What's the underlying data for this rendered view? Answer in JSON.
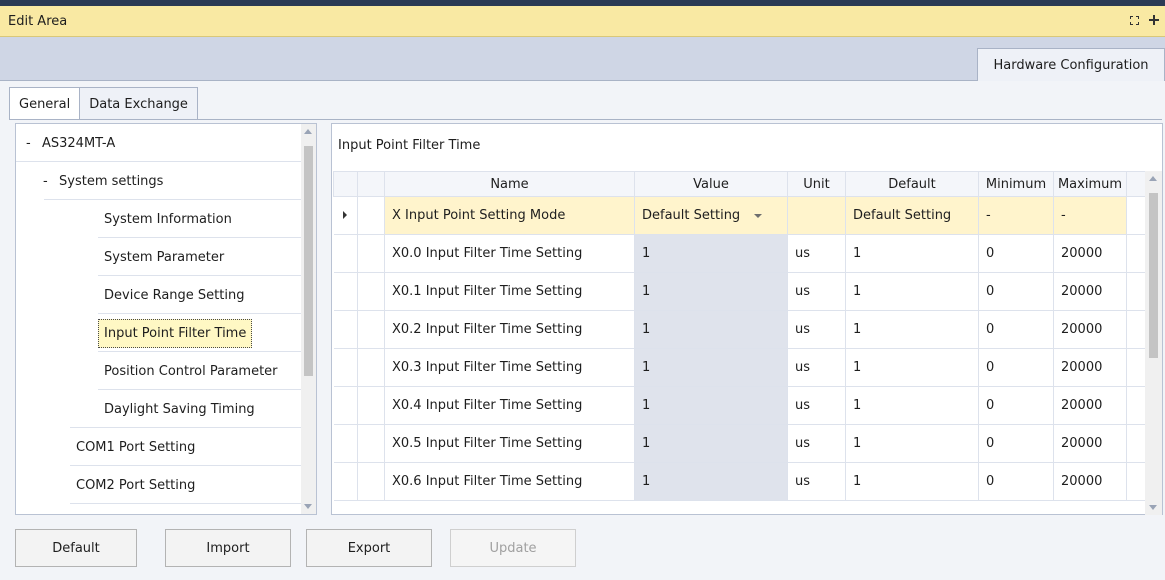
{
  "window": {
    "title": "Edit Area"
  },
  "doc_tab": "Hardware Configuration",
  "sub_tabs": [
    "General",
    "Data Exchange"
  ],
  "tree": {
    "root": "AS324MT-A",
    "group": "System settings",
    "items": [
      "System Information",
      "System Parameter",
      "Device Range Setting",
      "Input Point Filter Time",
      "Position Control Parameter",
      "Daylight Saving Timing"
    ],
    "siblings": [
      "COM1 Port Setting",
      "COM2 Port Setting"
    ],
    "selected": "Input Point Filter Time"
  },
  "grid": {
    "title": "Input Point Filter Time",
    "columns": [
      "Name",
      "Value",
      "Unit",
      "Default",
      "Minimum",
      "Maximum"
    ],
    "rows": [
      [
        "X Input Point Setting Mode",
        "Default Setting",
        "",
        "Default Setting",
        "-",
        "-"
      ],
      [
        "X0.0 Input Filter Time Setting",
        "1",
        "us",
        "1",
        "0",
        "20000"
      ],
      [
        "X0.1 Input Filter Time Setting",
        "1",
        "us",
        "1",
        "0",
        "20000"
      ],
      [
        "X0.2 Input Filter Time Setting",
        "1",
        "us",
        "1",
        "0",
        "20000"
      ],
      [
        "X0.3 Input Filter Time Setting",
        "1",
        "us",
        "1",
        "0",
        "20000"
      ],
      [
        "X0.4 Input Filter Time Setting",
        "1",
        "us",
        "1",
        "0",
        "20000"
      ],
      [
        "X0.5 Input Filter Time Setting",
        "1",
        "us",
        "1",
        "0",
        "20000"
      ],
      [
        "X0.6 Input Filter Time Setting",
        "1",
        "us",
        "1",
        "0",
        "20000"
      ]
    ]
  },
  "buttons": {
    "default": "Default",
    "import": "Import",
    "export": "Export",
    "update": "Update"
  }
}
